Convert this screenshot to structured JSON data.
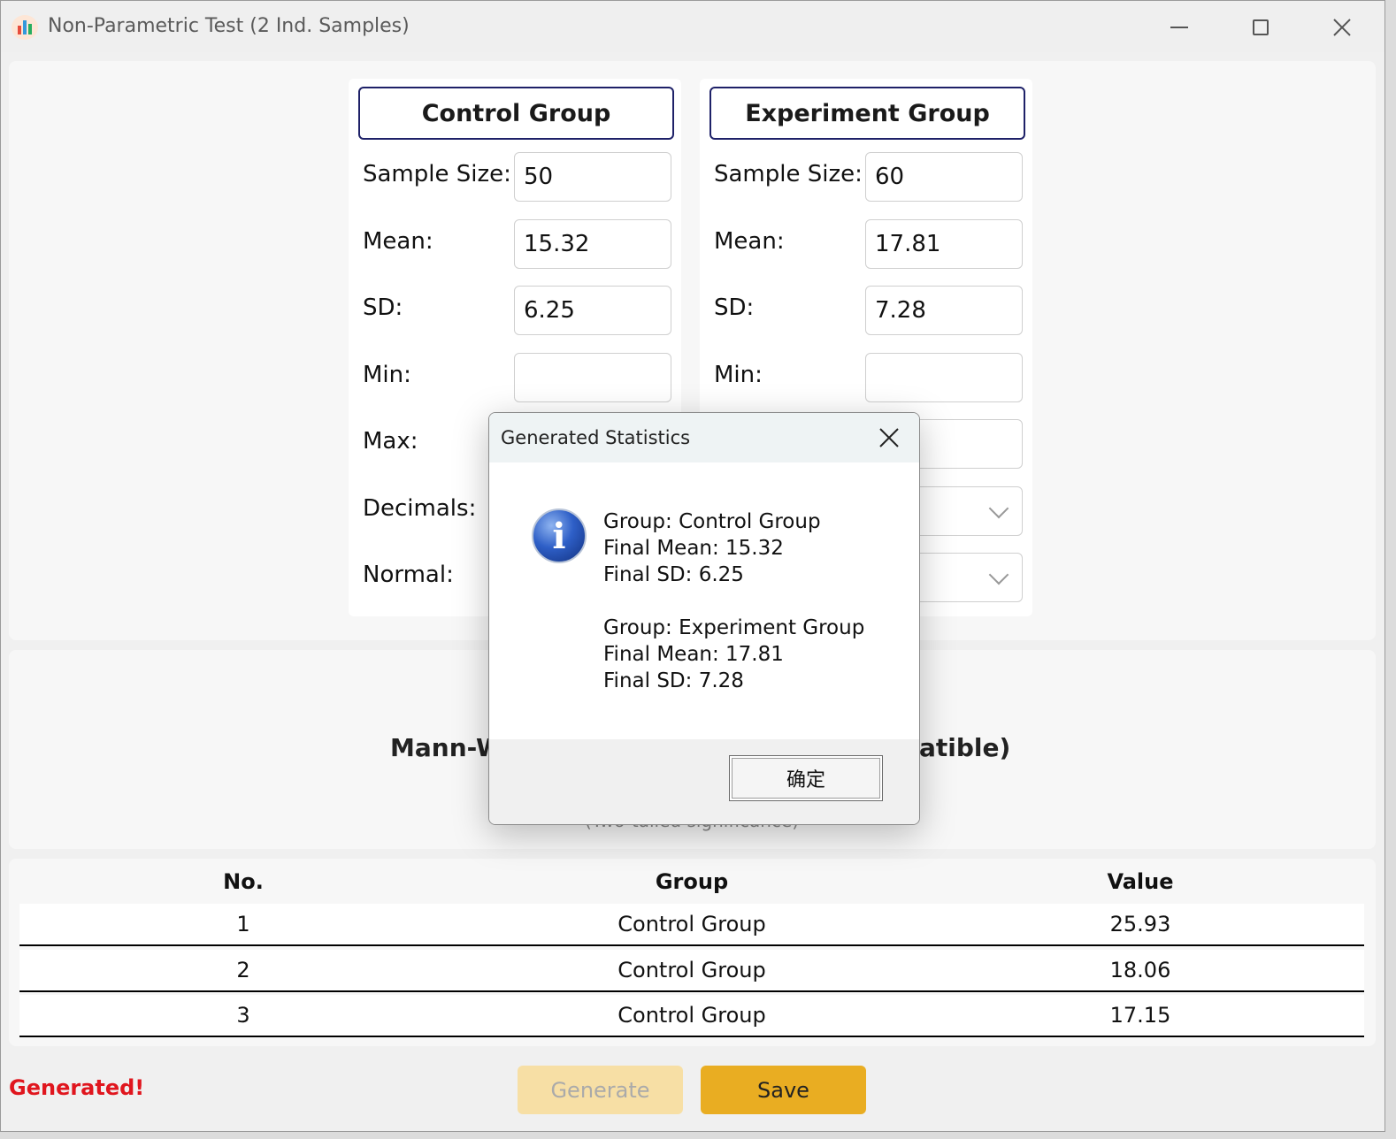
{
  "window": {
    "title": "Non-Parametric Test (2 Ind. Samples)"
  },
  "groups": [
    {
      "name": "Control Group",
      "labels": {
        "sample_size": "Sample Size:",
        "mean": "Mean:",
        "sd": "SD:",
        "min": "Min:",
        "max": "Max:",
        "decimals": "Decimals:",
        "normal": "Normal:"
      },
      "values": {
        "sample_size": "50",
        "mean": "15.32",
        "sd": "6.25",
        "min": ""
      }
    },
    {
      "name": "Experiment Group",
      "labels": {
        "sample_size": "Sample Size:",
        "mean": "Mean:",
        "sd": "SD:",
        "min": "Min:"
      },
      "values": {
        "sample_size": "60",
        "mean": "17.81",
        "sd": "7.28",
        "min": ""
      }
    }
  ],
  "result": {
    "title_left": "Mann-W",
    "title_right": "atible)",
    "subtitle": "(Two-tailed significance)"
  },
  "table": {
    "headers": [
      "No.",
      "Group",
      "Value"
    ],
    "rows": [
      [
        "1",
        "Control Group",
        "25.93"
      ],
      [
        "2",
        "Control Group",
        "18.06"
      ],
      [
        "3",
        "Control Group",
        "17.15"
      ]
    ]
  },
  "status": "Generated!",
  "buttons": {
    "generate": "Generate",
    "save": "Save"
  },
  "dialog": {
    "title": "Generated Statistics",
    "lines_group1": [
      "Group: Control Group",
      "Final Mean: 15.32",
      "Final SD: 6.25"
    ],
    "lines_group2": [
      "Group: Experiment Group",
      "Final Mean: 17.81",
      "Final SD: 7.28"
    ],
    "ok": "确定"
  },
  "icons": {
    "app": "bar-chart-icon",
    "info": "info-icon"
  },
  "colors": {
    "accent": "#e9ad22",
    "status": "#e0161e",
    "group_border": "#1e2168"
  }
}
